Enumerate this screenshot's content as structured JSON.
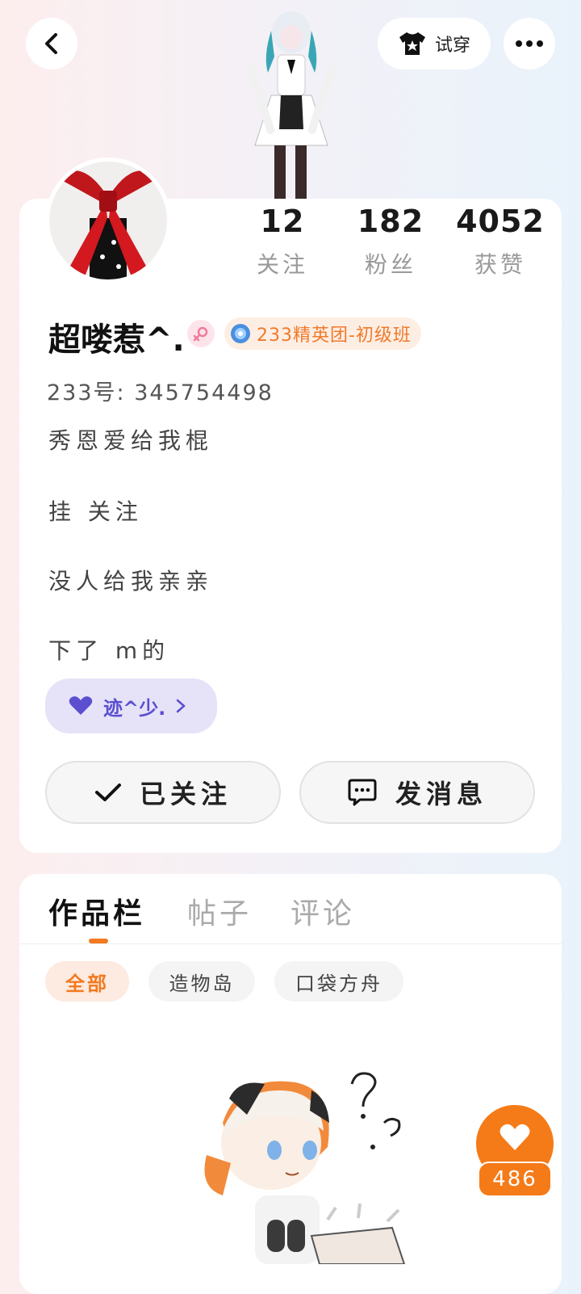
{
  "header": {
    "try_on_label": "试穿"
  },
  "stats": [
    {
      "value": "12",
      "label": "关注"
    },
    {
      "value": "182",
      "label": "粉丝"
    },
    {
      "value": "4052",
      "label": "获赞"
    }
  ],
  "profile": {
    "name": "超喽惹^.",
    "badge_label": "233精英团-初级班",
    "uid_line": "233号: 345754498",
    "bio_lines": [
      "秀恩爱给我棍",
      "挂 关注",
      "没人给我亲亲",
      "下了 m的"
    ],
    "guild_label": "迹^少."
  },
  "actions": {
    "follow_label": "已关注",
    "message_label": "发消息"
  },
  "tabs": [
    {
      "label": "作品栏",
      "active": true
    },
    {
      "label": "帖子",
      "active": false
    },
    {
      "label": "评论",
      "active": false
    }
  ],
  "filters": [
    {
      "label": "全部",
      "active": true
    },
    {
      "label": "造物岛",
      "active": false
    },
    {
      "label": "口袋方舟",
      "active": false
    }
  ],
  "like_button": {
    "count": "486"
  },
  "colors": {
    "accent_orange": "#f27a20",
    "guild_purple": "#5b4fd0",
    "gender_pink": "#f07a9a"
  }
}
